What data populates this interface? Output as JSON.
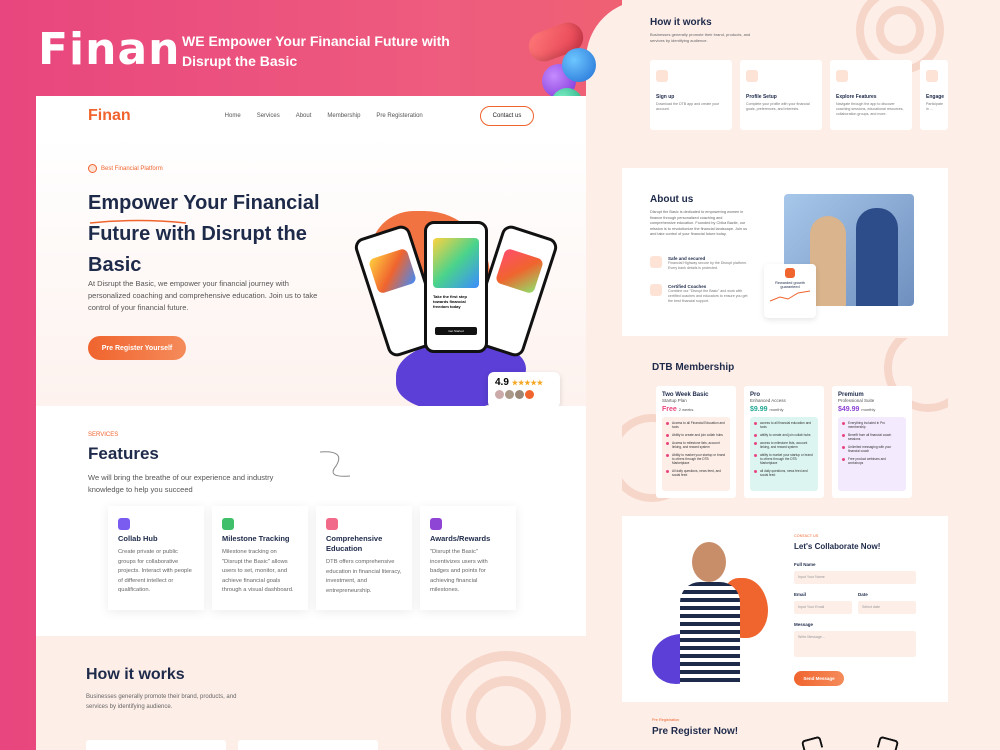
{
  "brand": {
    "name": "Finan",
    "tagline": "WE Empower Your Financial Future with Disrupt the Basic"
  },
  "colors": {
    "accent": "#f0642e",
    "navy": "#1e2a4a",
    "pink": "#e8467e",
    "peach": "#fdeee8"
  },
  "nav": {
    "logo": "Finan",
    "links": [
      "Home",
      "Services",
      "About",
      "Membership",
      "Pre Registeration"
    ],
    "contact": "Contact us"
  },
  "hero": {
    "badge": "Best Financial Platform",
    "title": "Empower Your Financial Future with Disrupt the Basic",
    "description": "At Disrupt the Basic, we empower your financial journey with personalized coaching and comprehensive education. Join us to take control of your financial future.",
    "button": "Pre Register Yourself",
    "phone_text": "Take the first step towards financial freedom today",
    "phone_button": "Get Started",
    "rating": "4.9"
  },
  "features": {
    "kicker": "SERVICES",
    "title": "Features",
    "description": "We will bring the breathe of our experience and industry knowledge to help you succeed",
    "cards": [
      {
        "title": "Collab Hub",
        "text": "Create private or public groups for collaborative projects. Interact with people of different intellect or qualification.",
        "icon": "people-icon",
        "color": "#7b5cf0"
      },
      {
        "title": "Milestone Tracking",
        "text": "Milestone tracking on \"Disrupt the Basic\" allows users to set, monitor, and achieve financial goals through a visual dashboard.",
        "icon": "tracking-icon",
        "color": "#3fbf6a"
      },
      {
        "title": "Comprehensive Education",
        "text": "DTB offers comprehensive education in financial literacy, investment, and entrepreneurship.",
        "icon": "chart-icon",
        "color": "#f26a8a"
      },
      {
        "title": "Awards/Rewards",
        "text": "\"Disrupt the Basic\" incentivizes users with badges and points for achieving financial milestones.",
        "icon": "crown-icon",
        "color": "#8e44d4"
      }
    ]
  },
  "how_it_works": {
    "title": "How it works",
    "description": "Businesses generally promote their brand, products, and services by identifying audience.",
    "steps": [
      {
        "title": "Sign up",
        "text": "Download the DTB app and create your account."
      },
      {
        "title": "Profile Setup",
        "text": "Complete your profile with your financial goals, preferences, and interests."
      },
      {
        "title": "Explore Features",
        "text": "Navigate through the app to discover coaching sessions, educational resources, collaboration groups, and more."
      },
      {
        "title": "Engage",
        "text": "Participate in ..."
      }
    ]
  },
  "about": {
    "title": "About us",
    "description": "Disrupt the Basic is dedicated to empowering women in finance through personalized coaching and comprehensive education. Founded by Chika Bazile, our mission is to revolutionize the financial landscape. Join us and take control of your financial future today.",
    "features": [
      {
        "title": "Safe and secured",
        "text": "Financial Highway secure by the Disrupt platform. Every bank details is protected."
      },
      {
        "title": "Certified Coaches",
        "text": "Combine our \"Disrupt the Basic\" and work with certified coaches and educators to ensure you get the best financial support."
      }
    ],
    "growth": "Rewarded growth guaranteed"
  },
  "membership": {
    "title": "DTB Membership",
    "plans": [
      {
        "name": "Two Week Basic",
        "subtitle": "Startup Plan",
        "price": "Free",
        "period": "2 weeks",
        "bg": "#fdeee8",
        "color": "#e8467e",
        "features": [
          "Access to all Financial Education and tools",
          "Ability to create and join collab hubs",
          "Access to milestone lists, account linking, and reward system",
          "Ability to market your startup or brand to others through the DTB Marketplace",
          "All daily questions, news feed, and social feed"
        ]
      },
      {
        "name": "Pro",
        "subtitle": "Enhanced Access",
        "price": "$9.99",
        "period": "monthly",
        "bg": "#dcf5f0",
        "color": "#22a893",
        "features": [
          "access to all financial education and tools",
          "ability to create and join collab hubs",
          "access to milestone lists, account linking, and reward system",
          "ability to market your startup or brand to others through the DTB Marketplace",
          "all daily questions, news feed and social feed"
        ]
      },
      {
        "name": "Premium",
        "subtitle": "Professional Suite",
        "price": "$49.99",
        "period": "monthly",
        "bg": "#f3eafd",
        "color": "#8e44d4",
        "features": [
          "Everything included in Pro membership",
          "Benefit from all financial coach sessions",
          "Unlimited messaging with your financial coach",
          "Free product webinars and workshops"
        ]
      }
    ]
  },
  "contact": {
    "kicker": "CONTACT US",
    "title": "Let's Collaborate Now!",
    "full_name_label": "Full Name",
    "full_name_placeholder": "Input Your Name",
    "email_label": "Email",
    "email_placeholder": "Input Your Email",
    "date_label": "Date",
    "date_placeholder": "Select date",
    "message_label": "Message",
    "message_placeholder": "Write Message...",
    "send": "Send Message"
  },
  "pre_register": {
    "kicker": "Pre Registration",
    "title": "Pre Register Now!"
  }
}
